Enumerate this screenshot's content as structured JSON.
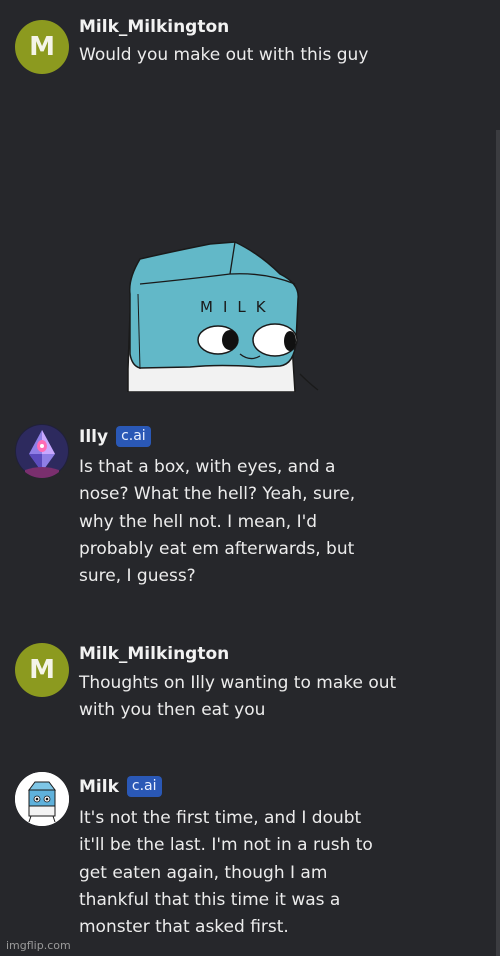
{
  "messages": [
    {
      "author": "Milk_Milkington",
      "avatar_letter": "M",
      "badge": "",
      "text": "Would you make out with this guy",
      "attachment": "box-character-drawing"
    },
    {
      "author": "Illy",
      "badge": "c.ai",
      "avatar_icon": "crystal-creature-avatar",
      "text": "Is that a box, with eyes, and a\nnose? What the hell? Yeah, sure,\nwhy the hell not. I mean, I'd\nprobably eat em afterwards, but\nsure, I guess?"
    },
    {
      "author": "Milk_Milkington",
      "avatar_letter": "M",
      "badge": "",
      "text": "Thoughts on Illy wanting to make out\nwith you then eat you"
    },
    {
      "author": "Milk",
      "badge": "c.ai",
      "avatar_icon": "milk-carton-avatar",
      "text": "It's not the first time, and I doubt\nit'll be the last. I'm not in a rush to\nget eaten again, though I am\nthankful that this time it was a\nmonster that asked first."
    }
  ],
  "drawing": {
    "label": "MILK"
  },
  "watermark": "imgflip.com",
  "colors": {
    "background": "#26272b",
    "avatar_green": "#8c9a1f",
    "badge_blue": "#2a58b6",
    "box_teal": "#62b8c8"
  }
}
